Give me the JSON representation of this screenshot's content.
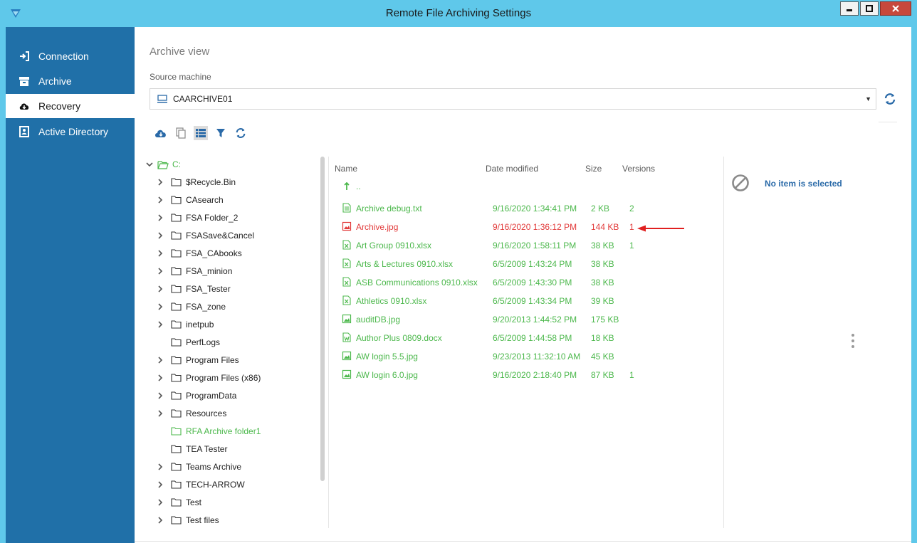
{
  "window": {
    "title": "Remote File Archiving Settings"
  },
  "sidebar": {
    "items": [
      {
        "label": "Connection",
        "icon": "sign-in-icon"
      },
      {
        "label": "Archive",
        "icon": "archive-box-icon"
      },
      {
        "label": "Recovery",
        "icon": "cloud-download-icon",
        "active": true
      },
      {
        "label": "Active Directory",
        "icon": "address-book-icon"
      }
    ]
  },
  "main": {
    "section_title": "Archive view",
    "source_label": "Source machine",
    "source_value": "CAARCHIVE01"
  },
  "toolbar": [
    "cloud-download-icon",
    "copy-icon",
    "list-view-icon",
    "filter-icon",
    "refresh-icon"
  ],
  "tree": {
    "root": "C:",
    "items": [
      {
        "label": "$Recycle.Bin",
        "expandable": true
      },
      {
        "label": "CAsearch",
        "expandable": true
      },
      {
        "label": "FSA Folder_2",
        "expandable": true
      },
      {
        "label": "FSASave&Cancel",
        "expandable": true
      },
      {
        "label": "FSA_CAbooks",
        "expandable": true
      },
      {
        "label": "FSA_minion",
        "expandable": true
      },
      {
        "label": "FSA_Tester",
        "expandable": true
      },
      {
        "label": "FSA_zone",
        "expandable": true
      },
      {
        "label": "inetpub",
        "expandable": true
      },
      {
        "label": "PerfLogs",
        "expandable": false
      },
      {
        "label": "Program Files",
        "expandable": true
      },
      {
        "label": "Program Files (x86)",
        "expandable": true
      },
      {
        "label": "ProgramData",
        "expandable": true
      },
      {
        "label": "Resources",
        "expandable": true
      },
      {
        "label": "RFA Archive folder1",
        "expandable": false,
        "selected": true
      },
      {
        "label": "TEA Tester",
        "expandable": false
      },
      {
        "label": "Teams Archive",
        "expandable": true
      },
      {
        "label": "TECH-ARROW",
        "expandable": true
      },
      {
        "label": "Test",
        "expandable": true
      },
      {
        "label": "Test files",
        "expandable": true
      }
    ]
  },
  "filelist": {
    "columns": [
      "Name",
      "Date modified",
      "Size",
      "Versions"
    ],
    "up_label": "..",
    "rows": [
      {
        "name": "Archive debug.txt",
        "date": "9/16/2020 1:34:41 PM",
        "size": "2 KB",
        "versions": "2",
        "icon": "text-file-icon"
      },
      {
        "name": "Archive.jpg",
        "date": "9/16/2020 1:36:12 PM",
        "size": "144 KB",
        "versions": "1",
        "icon": "image-file-icon",
        "highlight": true
      },
      {
        "name": "Art Group 0910.xlsx",
        "date": "9/16/2020 1:58:11 PM",
        "size": "38 KB",
        "versions": "1",
        "icon": "excel-file-icon"
      },
      {
        "name": "Arts & Lectures 0910.xlsx",
        "date": "6/5/2009 1:43:24 PM",
        "size": "38 KB",
        "versions": "",
        "icon": "excel-file-icon"
      },
      {
        "name": "ASB Communications 0910.xlsx",
        "date": "6/5/2009 1:43:30 PM",
        "size": "38 KB",
        "versions": "",
        "icon": "excel-file-icon"
      },
      {
        "name": "Athletics 0910.xlsx",
        "date": "6/5/2009 1:43:34 PM",
        "size": "39 KB",
        "versions": "",
        "icon": "excel-file-icon"
      },
      {
        "name": "auditDB.jpg",
        "date": "9/20/2013 1:44:52 PM",
        "size": "175 KB",
        "versions": "",
        "icon": "image-file-icon"
      },
      {
        "name": "Author Plus 0809.docx",
        "date": "6/5/2009 1:44:58 PM",
        "size": "18 KB",
        "versions": "",
        "icon": "word-file-icon"
      },
      {
        "name": "AW login 5.5.jpg",
        "date": "9/23/2013 11:32:10 AM",
        "size": "45 KB",
        "versions": "",
        "icon": "image-file-icon"
      },
      {
        "name": "AW login 6.0.jpg",
        "date": "9/16/2020 2:18:40 PM",
        "size": "87 KB",
        "versions": "1",
        "icon": "image-file-icon"
      }
    ]
  },
  "details": {
    "empty_text": "No item is selected"
  },
  "colors": {
    "title_bar": "#5fc8ea",
    "sidebar": "#2070a8",
    "archived_green": "#4cb84c",
    "highlight_red": "#e23a3a",
    "link_blue": "#2a6aa8"
  }
}
